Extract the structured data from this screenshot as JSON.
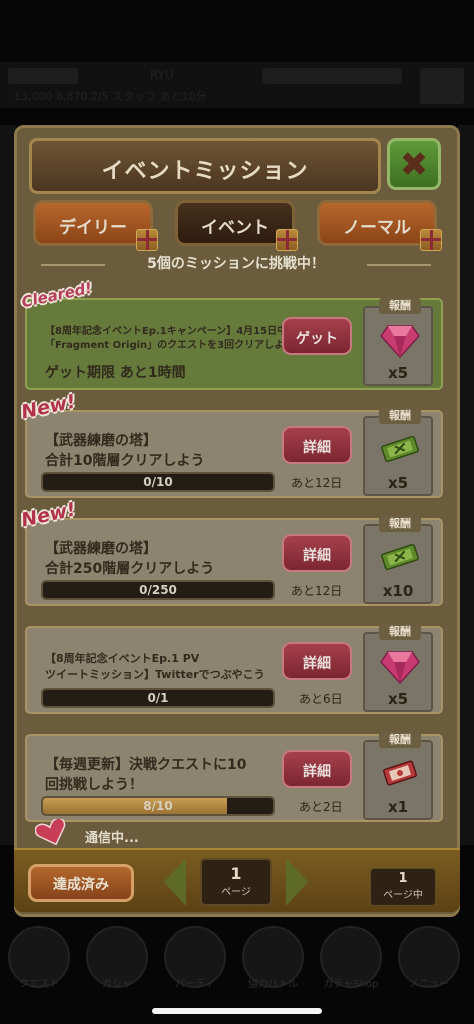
{
  "background": {
    "player_name": "RYU",
    "status_line": "13,000  8,870  2/5  スタッフ  あと10分",
    "nav_labels": [
      "クエスト",
      "ガシャ",
      "パーティ",
      "協力バトル",
      "ガチャShop",
      "メニュー"
    ]
  },
  "panel": {
    "title": "イベントミッション",
    "close_symbol": "✖",
    "tabs": [
      {
        "label": "デイリー",
        "active": false
      },
      {
        "label": "イベント",
        "active": true
      },
      {
        "label": "ノーマル",
        "active": false
      }
    ],
    "challenge_text": "5個のミッションに挑戦中！",
    "reward_label": "報酬",
    "missions": [
      {
        "badge": "Cleared!",
        "line1": "【8周年記念イベントEp.1キャンペーン】4月15日中に",
        "line2": "「Fragment Origin」のクエストを3回クリアしよう",
        "deadline": "ゲット期限  あと1時間",
        "button": "ゲット",
        "reward_icon": "gem-icon",
        "reward_count": "x5"
      },
      {
        "badge": "New!",
        "line1": "【武器練磨の塔】",
        "line2": "合計10階層クリアしよう",
        "progress_text": "0/10",
        "progress": 0,
        "button": "詳細",
        "remaining": "あと12日",
        "reward_icon": "ticket-icon",
        "reward_count": "x5"
      },
      {
        "badge": "New!",
        "line1": "【武器練磨の塔】",
        "line2": "合計250階層クリアしよう",
        "progress_text": "0/250",
        "progress": 0,
        "button": "詳細",
        "remaining": "あと12日",
        "reward_icon": "ticket-icon",
        "reward_count": "x10"
      },
      {
        "line1": "【8周年記念イベントEp.1 PV",
        "line2": "ツイートミッション】Twitterでつぶやこう",
        "progress_text": "0/1",
        "progress": 0,
        "button": "詳細",
        "remaining": "あと6日",
        "reward_icon": "gem-icon",
        "reward_count": "x5"
      },
      {
        "line1": "【毎週更新】決戦クエストに10",
        "line2": "回挑戦しよう！",
        "progress_text": "8/10",
        "progress": 0.8,
        "button": "詳細",
        "remaining": "あと2日",
        "reward_icon": "red-ticket-icon",
        "reward_count": "x1"
      }
    ],
    "communicating": "通信中..."
  },
  "bottom": {
    "done_button": "達成済み",
    "page": "1",
    "page_unit": "ページ",
    "total_pages": "1",
    "total_unit": "ページ中"
  },
  "colors": {
    "panel": "#6a5c3c",
    "cleared_card": "#667a3c",
    "card": "#8d8470",
    "red_button": "#a5404b",
    "orange_tab": "#b8672c"
  }
}
